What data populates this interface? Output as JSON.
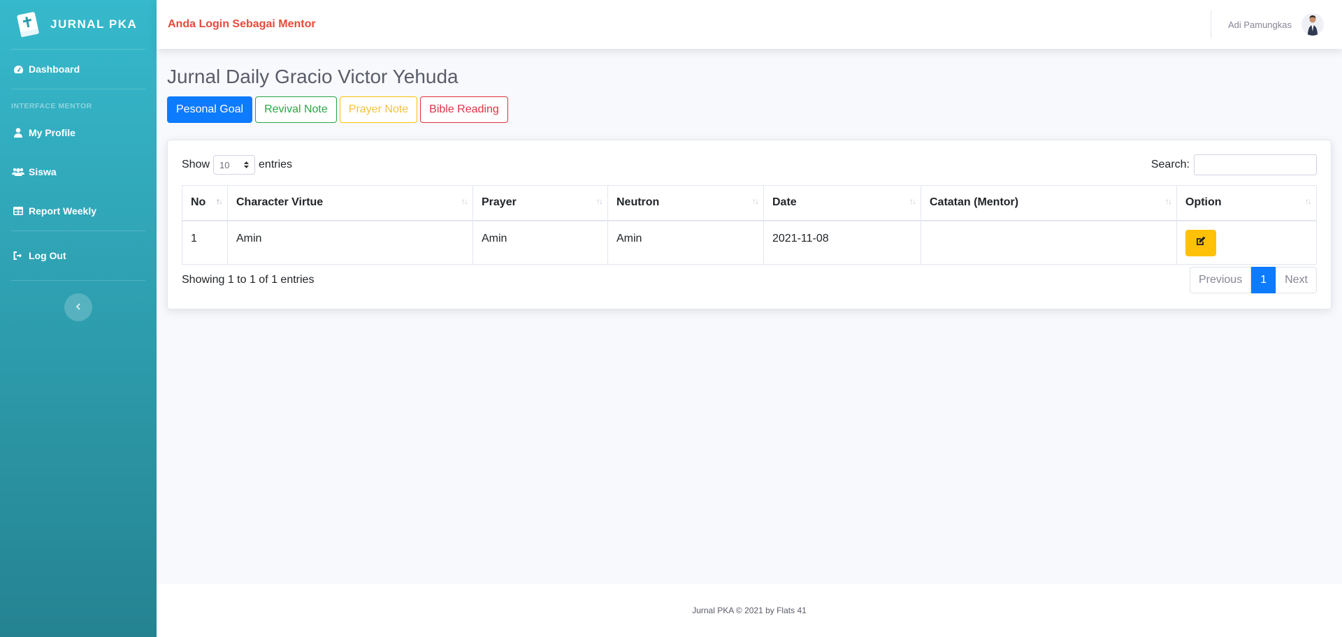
{
  "brand": {
    "name": "JURNAL PKA",
    "logo_icon": "bible-icon"
  },
  "sidebar": {
    "items": [
      {
        "label": "Dashboard",
        "icon": "tachometer-icon"
      },
      {
        "heading": "INTERFACE MENTOR"
      },
      {
        "label": "My Profile",
        "icon": "user-icon"
      },
      {
        "label": "Siswa",
        "icon": "users-icon"
      },
      {
        "label": "Report Weekly",
        "icon": "table-icon"
      },
      {
        "label": "Log Out",
        "icon": "sign-out-icon"
      }
    ],
    "toggle_icon": "chevron-left-icon"
  },
  "topbar": {
    "login_message": "Anda Login Sebagai Mentor",
    "user_name": "Adi Pamungkas"
  },
  "page": {
    "title": "Jurnal Daily Gracio Victor Yehuda",
    "buttons": [
      "Pesonal Goal",
      "Revival Note",
      "Prayer Note",
      "Bible Reading"
    ]
  },
  "table": {
    "show_label": "Show",
    "entries_label": "entries",
    "page_length": "10",
    "search_label": "Search:",
    "search_value": "",
    "columns": [
      "No",
      "Character Virtue",
      "Prayer",
      "Neutron",
      "Date",
      "Catatan (Mentor)",
      "Option"
    ],
    "rows": [
      {
        "no": "1",
        "character_virtue": "Amin",
        "prayer": "Amin",
        "neutron": "Amin",
        "date": "2021-11-08",
        "catatan": "",
        "option_icon": "edit-icon"
      }
    ],
    "info": "Showing 1 to 1 of 1 entries",
    "pagination": {
      "previous": "Previous",
      "current": "1",
      "next": "Next"
    }
  },
  "footer": {
    "text": "Jurnal PKA © 2021 by Flats 41"
  },
  "colors": {
    "sidebar_top": "#36b9cc",
    "sidebar_bottom": "#258391",
    "primary": "#0d7bfd",
    "success": "#28a745",
    "warning": "#ffc107",
    "danger": "#dc3545"
  }
}
